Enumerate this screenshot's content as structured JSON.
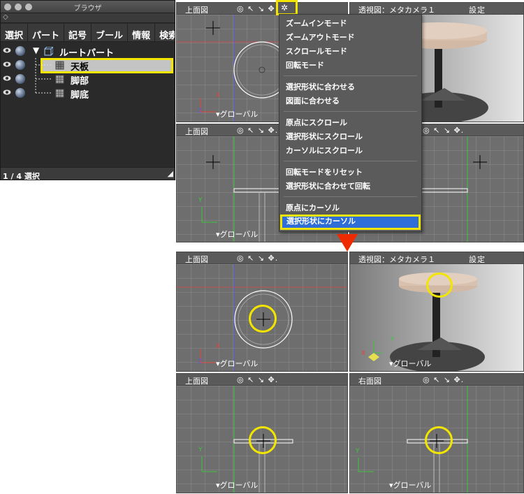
{
  "browser": {
    "title": "ブラウザ",
    "tabs": [
      "選択",
      "パート",
      "記号",
      "ブール",
      "情報",
      "検索"
    ],
    "tree": [
      {
        "label": "ルートパート"
      },
      {
        "label": "天板"
      },
      {
        "label": "脚部"
      },
      {
        "label": "脚底"
      }
    ],
    "status": "1 / 4 選択"
  },
  "viewports": {
    "top_view": "上面図",
    "front_view": "上面図",
    "persp_view": "透視図：メタカメラ１",
    "persp_setting": "設定",
    "right_view": "右面図",
    "global": "▾グローバル",
    "top_icons": "◎ ↖ ↘ ✥.",
    "nav_icons": "✥ ⟲ 🔍 ●",
    "axis_x": "X",
    "axis_y": "Y",
    "axis_z": "Z"
  },
  "menu": {
    "items": [
      "ズームインモード",
      "ズームアウトモード",
      "スクロールモード",
      "回転モード",
      "選択形状に合わせる",
      "図面に合わせる",
      "原点にスクロール",
      "選択形状にスクロール",
      "カーソルにスクロール",
      "回転モードをリセット",
      "選択形状に合わせて回転",
      "原点にカーソル",
      "選択形状にカーソル"
    ]
  },
  "colors": {
    "highlight": "#f2e600",
    "selected_menu": "#2f6ed6",
    "arrow": "#ee2a00",
    "viewport_bg": "#6e6e6e"
  }
}
